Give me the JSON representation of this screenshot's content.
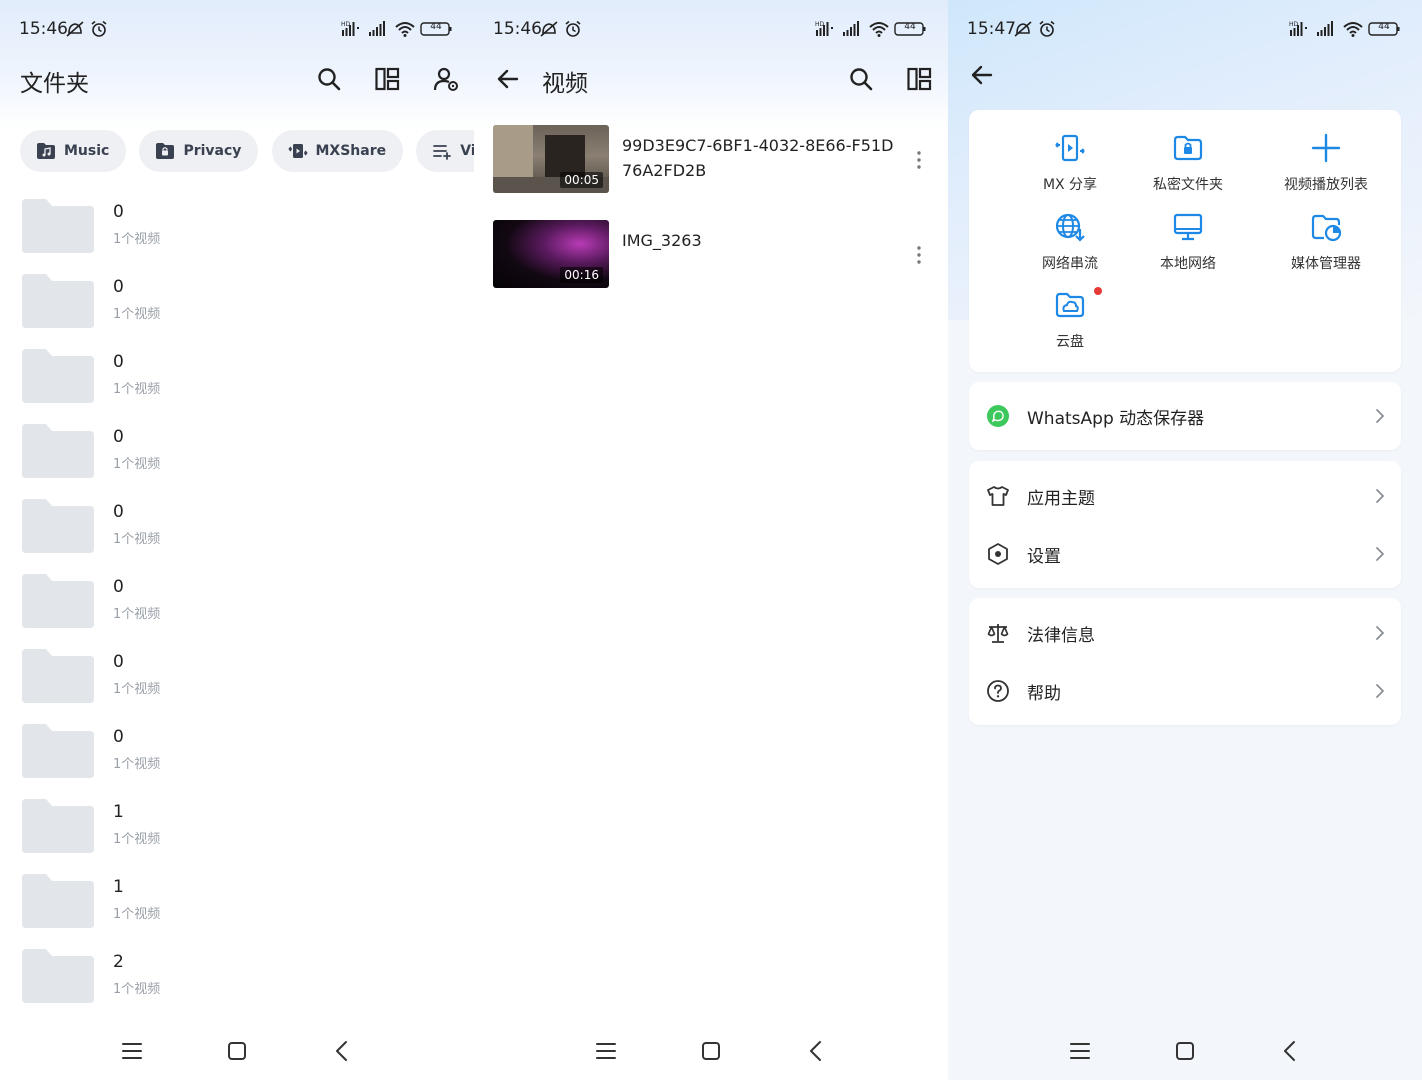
{
  "colors": {
    "accent": "#1e88e5",
    "folder": "#e2e6ea",
    "whatsapp": "#3cc85a",
    "dot": "#e53935"
  },
  "screens": {
    "folders": {
      "time": "15:46",
      "battery": "44",
      "title": "文件夹",
      "icons": [
        "search-icon",
        "grid-layout-icon",
        "user-settings-icon"
      ],
      "chips": [
        {
          "label": "Music",
          "icon": "music-folder-icon"
        },
        {
          "label": "Privacy",
          "icon": "lock-folder-icon"
        },
        {
          "label": "MXShare",
          "icon": "share-icon"
        },
        {
          "label": "Video l",
          "icon": "playlist-add-icon"
        }
      ],
      "folders": [
        {
          "name": "0",
          "count": "1个视频"
        },
        {
          "name": "0",
          "count": "1个视频"
        },
        {
          "name": "0",
          "count": "1个视频"
        },
        {
          "name": "0",
          "count": "1个视频"
        },
        {
          "name": "0",
          "count": "1个视频"
        },
        {
          "name": "0",
          "count": "1个视频"
        },
        {
          "name": "0",
          "count": "1个视频"
        },
        {
          "name": "0",
          "count": "1个视频"
        },
        {
          "name": "1",
          "count": "1个视频"
        },
        {
          "name": "1",
          "count": "1个视频"
        },
        {
          "name": "2",
          "count": "1个视频"
        }
      ]
    },
    "videos": {
      "time": "15:46",
      "battery": "44",
      "title": "视频",
      "items": [
        {
          "title": "99D3E9C7-6BF1-4032-8E66-F51D76A2FD2B",
          "duration": "00:05"
        },
        {
          "title": "IMG_3263",
          "duration": "00:16"
        }
      ]
    },
    "settings": {
      "time": "15:47",
      "battery": "44",
      "grid": [
        {
          "label": "MX 分享",
          "icon": "mx-share-icon"
        },
        {
          "label": "私密文件夹",
          "icon": "private-folder-icon"
        },
        {
          "label": "视频播放列表",
          "icon": "plus-icon"
        },
        {
          "label": "网络串流",
          "icon": "network-stream-icon"
        },
        {
          "label": "本地网络",
          "icon": "monitor-icon"
        },
        {
          "label": "媒体管理器",
          "icon": "media-manager-icon"
        },
        {
          "label": "云盘",
          "icon": "cloud-drive-icon"
        }
      ],
      "whatsapp": "WhatsApp 动态保存器",
      "menu_group1": [
        {
          "label": "应用主题",
          "icon": "shirt-icon"
        },
        {
          "label": "设置",
          "icon": "settings-hex-icon"
        }
      ],
      "menu_group2": [
        {
          "label": "法律信息",
          "icon": "scale-icon"
        },
        {
          "label": "帮助",
          "icon": "help-icon"
        }
      ]
    }
  }
}
